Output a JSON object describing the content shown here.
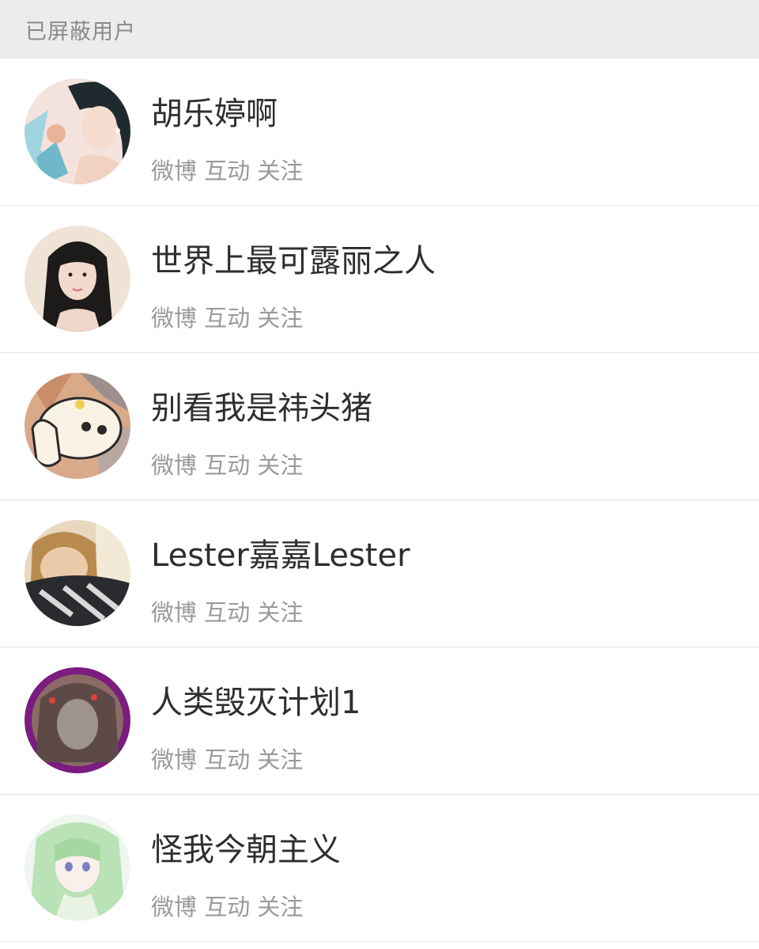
{
  "header": {
    "title": "已屏蔽用户",
    "background": "#ececec"
  },
  "users": [
    {
      "name": "胡乐婷啊",
      "tags": "微博 互动 关注",
      "avatar_icon": "woman-portrait-avatar"
    },
    {
      "name": "世界上最可露丽之人",
      "tags": "微博 互动 关注",
      "avatar_icon": "woman-portrait-avatar"
    },
    {
      "name": "别看我是祎头猪",
      "tags": "微博 互动 关注",
      "avatar_icon": "cartoon-character-avatar"
    },
    {
      "name": "Lester嘉嘉Lester",
      "tags": "微博 互动 关注",
      "avatar_icon": "person-with-scarf-avatar"
    },
    {
      "name": "人类毁灭计划1",
      "tags": "微博 互动 关注",
      "avatar_icon": "blurred-face-avatar"
    },
    {
      "name": "怪我今朝主义",
      "tags": "微博 互动 关注",
      "avatar_icon": "anime-girl-avatar"
    }
  ],
  "colors": {
    "name_text": "#2e2e2e",
    "tag_text": "#9a9a9a",
    "divider": "#e4e4e4"
  }
}
